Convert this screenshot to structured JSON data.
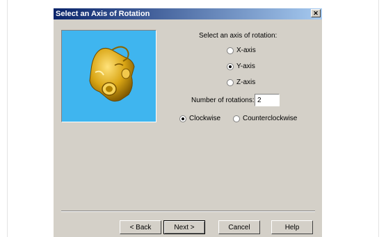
{
  "dialog": {
    "title": "Select an Axis of Rotation",
    "close_glyph": "✕"
  },
  "axis": {
    "prompt": "Select an axis of rotation:",
    "options": [
      "X-axis",
      "Y-axis",
      "Z-axis"
    ],
    "selected": "Y-axis"
  },
  "rotations": {
    "label": "Number of rotations:",
    "value": "2"
  },
  "direction": {
    "options": [
      "Clockwise",
      "Counterclockwise"
    ],
    "selected": "Clockwise"
  },
  "buttons": {
    "back": "< Back",
    "next": "Next >",
    "cancel": "Cancel",
    "help": "Help"
  },
  "colors": {
    "preview_bg": "#3fb5ef",
    "part_gold": "#d9a514",
    "title_start": "#0a246a",
    "title_end": "#a6caf0"
  }
}
